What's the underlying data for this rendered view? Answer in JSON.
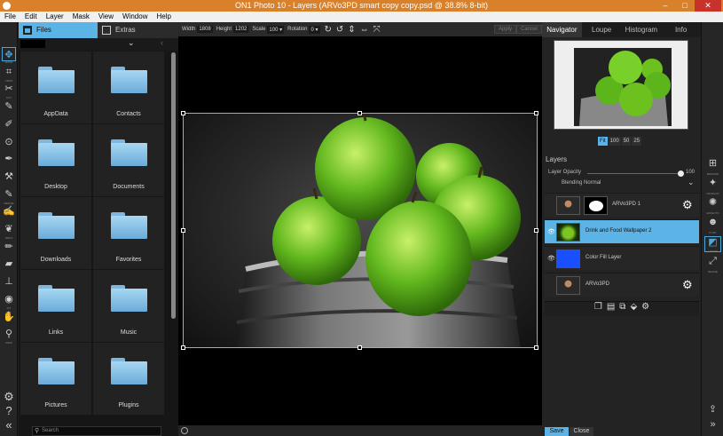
{
  "window": {
    "title": "ON1 Photo 10 - Layers (ARVo3PD smart copy copy.psd @ 38.8% 8-bit)",
    "min_label": "–",
    "max_label": "□",
    "close_label": "✕"
  },
  "menu": [
    "File",
    "Edit",
    "Layer",
    "Mask",
    "View",
    "Window",
    "Help"
  ],
  "tools": [
    {
      "name": "move",
      "glyph": "✥",
      "label": "MOVE",
      "active": true
    },
    {
      "name": "crop",
      "glyph": "⌗",
      "label": "CROP"
    },
    {
      "name": "cut",
      "glyph": "✂",
      "label": "CUT"
    },
    {
      "name": "brush",
      "glyph": "✎",
      "label": ""
    },
    {
      "name": "retouch",
      "glyph": "✐",
      "label": ""
    },
    {
      "name": "eye",
      "glyph": "⊙",
      "label": ""
    },
    {
      "name": "pen",
      "glyph": "✒",
      "label": ""
    },
    {
      "name": "chisel",
      "glyph": "⚒",
      "label": ""
    },
    {
      "name": "refine-brush",
      "glyph": "✎",
      "label": "REFINE"
    },
    {
      "name": "masking-brush",
      "glyph": "✍",
      "label": ""
    },
    {
      "name": "paint",
      "glyph": "❦",
      "label": "PAINT"
    },
    {
      "name": "clone-stamp",
      "glyph": "✏",
      "label": ""
    },
    {
      "name": "eraser",
      "glyph": "▰",
      "label": ""
    },
    {
      "name": "stamp",
      "glyph": "⊥",
      "label": ""
    },
    {
      "name": "red-eye",
      "glyph": "◉",
      "label": "FIX"
    },
    {
      "name": "hand",
      "glyph": "✋",
      "label": ""
    },
    {
      "name": "zoom",
      "glyph": "⚲",
      "label": "VIEW"
    }
  ],
  "bottom_tools": [
    {
      "name": "settings",
      "glyph": "⚙"
    },
    {
      "name": "help",
      "glyph": "?"
    },
    {
      "name": "collapse",
      "glyph": "«"
    }
  ],
  "browser": {
    "tabs": [
      {
        "name": "files",
        "label": "Files",
        "active": true
      },
      {
        "name": "extras",
        "label": "Extras"
      }
    ],
    "chevron": "⌄",
    "back": "‹",
    "folders": [
      "AppData",
      "Contacts",
      "Desktop",
      "Documents",
      "Downloads",
      "Favorites",
      "Links",
      "Music",
      "Pictures",
      "Plugins"
    ],
    "search_placeholder": "Search"
  },
  "tool_options": {
    "width_label": "Width",
    "width_value": "1808",
    "height_label": "Height",
    "height_value": "1202",
    "scale_label": "Scale",
    "scale_value": "100 ▾",
    "rotation_label": "Rotation",
    "rotation_value": "0 ▾",
    "apply_label": "Apply",
    "cancel_label": "Cancel"
  },
  "right_tabs": [
    {
      "name": "navigator",
      "label": "Navigator",
      "active": true
    },
    {
      "name": "loupe",
      "label": "Loupe"
    },
    {
      "name": "histogram",
      "label": "Histogram"
    },
    {
      "name": "info",
      "label": "Info"
    }
  ],
  "zoom": [
    "Fit",
    "100",
    "50",
    "25"
  ],
  "layers": {
    "title": "Layers",
    "opacity_label": "Layer Opacity",
    "opacity_value": "100",
    "opacity": 1.0,
    "blending_label": "Blending",
    "blending_value": "Normal",
    "items": [
      {
        "name": "ARVo3PD 1",
        "visible": false,
        "selected": false,
        "has_mask": true,
        "thumb": "portrait",
        "gear": true
      },
      {
        "name": "Drink and Food Wallpaper 2",
        "visible": true,
        "selected": true,
        "has_mask": false,
        "thumb": "apples",
        "gear": false
      },
      {
        "name": "Color Fill Layer",
        "visible": true,
        "selected": false,
        "has_mask": false,
        "thumb": "blue",
        "gear": false
      },
      {
        "name": "ARVo3PD",
        "visible": false,
        "selected": false,
        "has_mask": false,
        "thumb": "portrait",
        "gear": true
      }
    ]
  },
  "layer_buttons": [
    "duplicate-layer",
    "new-layer",
    "merge-layer",
    "fill-layer",
    "layer-settings"
  ],
  "actions": {
    "save_label": "Save",
    "close_label": "Close"
  },
  "modules": [
    {
      "name": "browse",
      "glyph": "⊞",
      "label": "BROWSE"
    },
    {
      "name": "develop",
      "glyph": "✦",
      "label": "DEVELOP"
    },
    {
      "name": "effects",
      "glyph": "✺",
      "label": "EFFECTS"
    },
    {
      "name": "portrait",
      "glyph": "☻",
      "label": "PORT"
    },
    {
      "name": "layers",
      "glyph": "◩",
      "label": "LAYERS",
      "active": true
    },
    {
      "name": "resize",
      "glyph": "⤢",
      "label": "RESIZE"
    }
  ],
  "colors": {
    "accent": "#5bb3e6",
    "title_bar": "#d9812a",
    "fill_layer": "#1a4fff"
  }
}
